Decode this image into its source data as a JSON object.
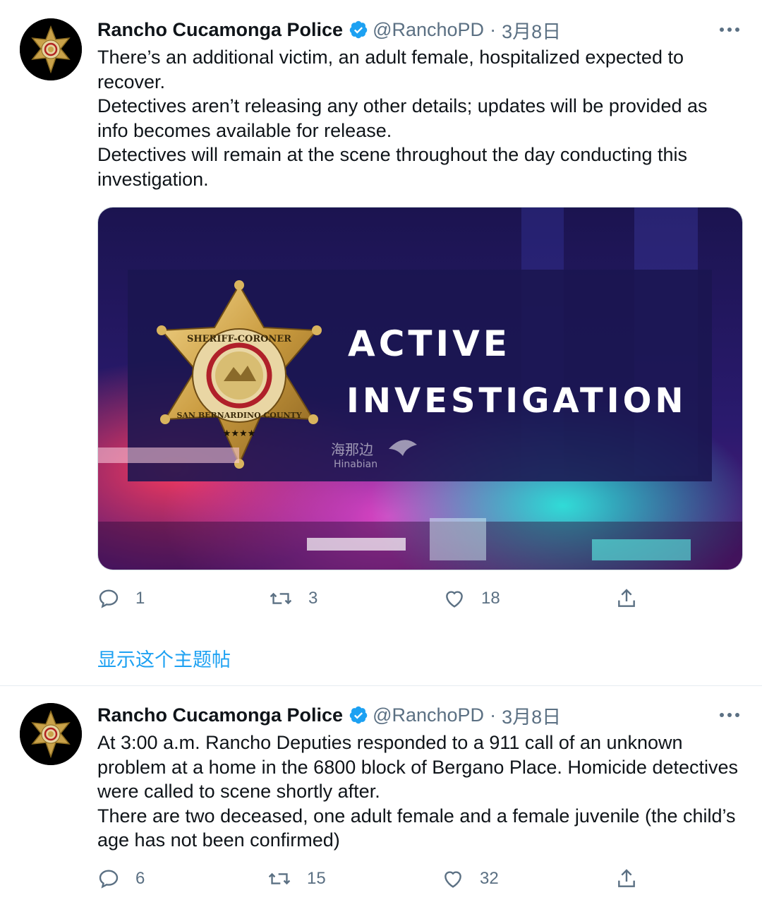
{
  "colors": {
    "accent": "#1da1f2",
    "secondary_text": "#5b7083",
    "primary_text": "#0f1419",
    "divider": "#e6ecf0"
  },
  "tweets": [
    {
      "author": {
        "display_name": "Rancho Cucamonga Police",
        "handle": "@RanchoPD",
        "verified_icon": "verified-badge-icon",
        "avatar_icon": "sheriff-star-icon"
      },
      "separator": "·",
      "time": "3月8日",
      "lines": [
        "There’s an additional victim, an adult female, hospitalized expected to recover.",
        "Detectives aren’t releasing any other details; updates will be provided as info becomes available for release.",
        "Detectives will remain at the scene throughout the day conducting this investigation."
      ],
      "media": {
        "headline_1": "ACTIVE",
        "headline_2": "INVESTIGATION",
        "badge_top_text": "SHERIFF-CORONER",
        "badge_bottom_text": "SAN BERNARDINO COUNTY",
        "badge_stars": "★★★★",
        "watermark_cn": "海那边",
        "watermark_en": "Hinabian"
      },
      "actions": {
        "replies": "1",
        "retweets": "3",
        "likes": "18"
      },
      "show_thread": "显示这个主题帖"
    },
    {
      "author": {
        "display_name": "Rancho Cucamonga Police",
        "handle": "@RanchoPD",
        "verified_icon": "verified-badge-icon",
        "avatar_icon": "sheriff-star-icon"
      },
      "separator": "·",
      "time": "3月8日",
      "lines": [
        "At 3:00 a.m. Rancho Deputies responded to a 911 call of an unknown problem at a home in the 6800 block of Bergano Place. Homicide detectives were called to scene shortly after.",
        "There are two deceased, one adult female and a female juvenile (the child’s age has not been confirmed)"
      ],
      "actions": {
        "replies": "6",
        "retweets": "15",
        "likes": "32"
      }
    }
  ]
}
